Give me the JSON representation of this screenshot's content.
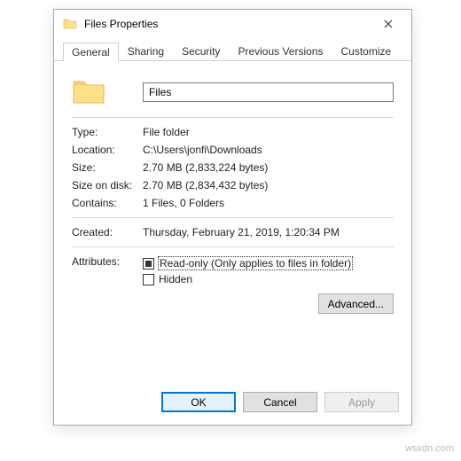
{
  "title": "Files Properties",
  "tabs": [
    "General",
    "Sharing",
    "Security",
    "Previous Versions",
    "Customize"
  ],
  "name_value": "Files",
  "fields": {
    "type_label": "Type:",
    "type_value": "File folder",
    "location_label": "Location:",
    "location_value": "C:\\Users\\jonfi\\Downloads",
    "size_label": "Size:",
    "size_value": "2.70 MB (2,833,224 bytes)",
    "sizeondisk_label": "Size on disk:",
    "sizeondisk_value": "2.70 MB (2,834,432 bytes)",
    "contains_label": "Contains:",
    "contains_value": "1 Files, 0 Folders",
    "created_label": "Created:",
    "created_value": "Thursday, February 21, 2019, 1:20:34 PM",
    "attributes_label": "Attributes:",
    "readonly_label": "Read-only (Only applies to files in folder)",
    "hidden_label": "Hidden",
    "advanced_label": "Advanced..."
  },
  "buttons": {
    "ok": "OK",
    "cancel": "Cancel",
    "apply": "Apply"
  },
  "watermark": "wsxdn.com"
}
